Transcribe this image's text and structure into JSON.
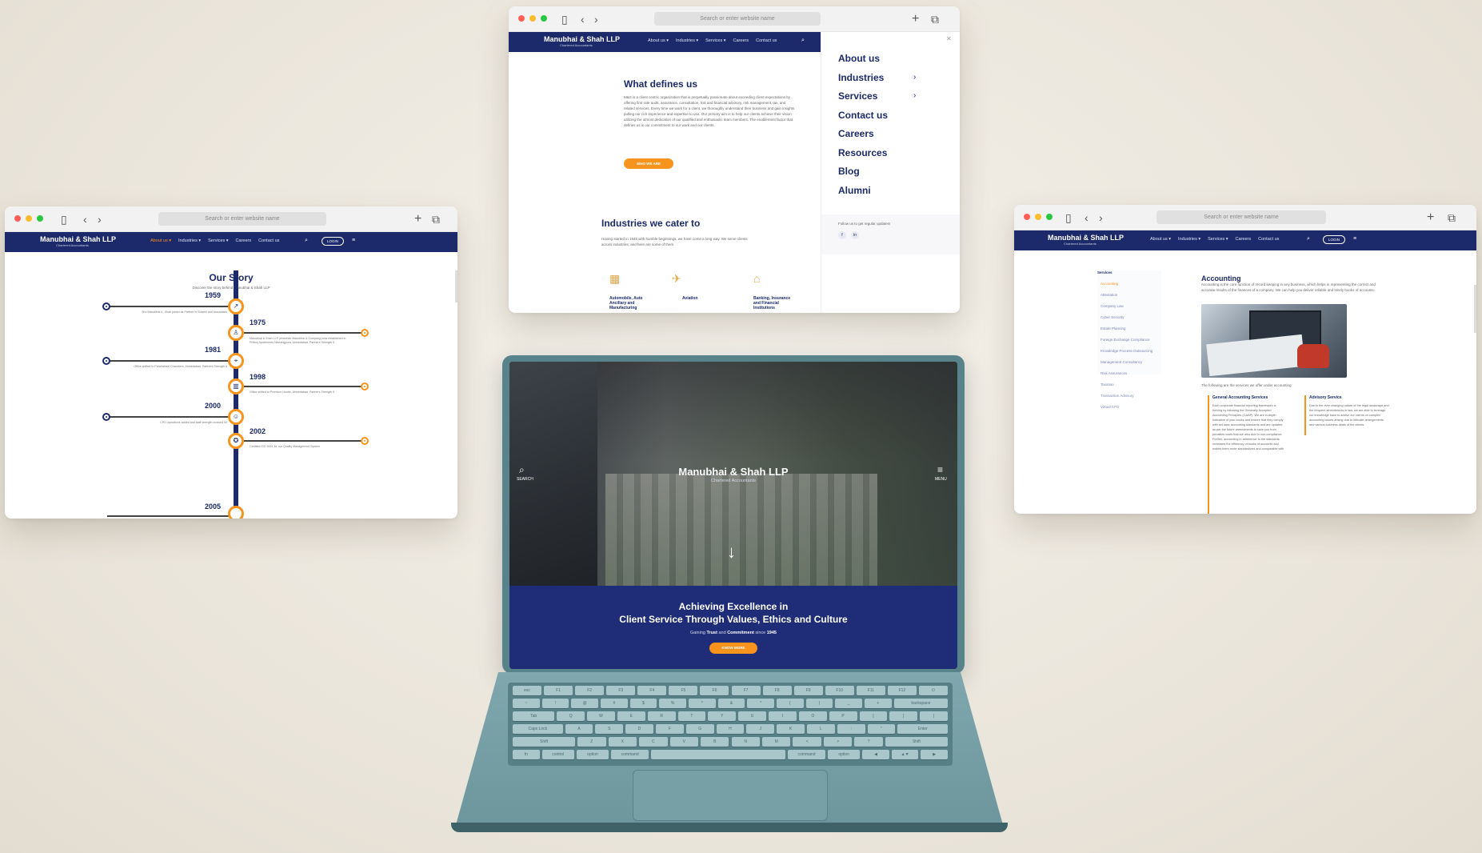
{
  "colors": {
    "navy": "#1c2a6b",
    "orange": "#f7941d",
    "hero_band": "#1f2d78"
  },
  "browser": {
    "url_placeholder": "Search or enter website name",
    "icons": [
      "sidebar-icon",
      "back-icon",
      "forward-icon",
      "new-tab-icon",
      "tabs-icon"
    ]
  },
  "brand": {
    "name": "Manubhai & Shah LLP",
    "tagline": "Chartered Accountants"
  },
  "nav": {
    "about": "About us ▾",
    "industries": "Industries ▾",
    "services": "Services ▾",
    "careers": "Careers",
    "contact": "Contact us",
    "login": "LOGIN"
  },
  "top_window": {
    "heading": "What defines us",
    "body": "M&S is a client centric organization that is perpetually passionate about exceeding client expectations by offering first rate audit, assurance, consultation, risk and financial advisory, risk management, tax, and related services. Every time we work for a client, we thoroughly understand their business and gain insights pulling our rich experience and expertise to use. Our primary aim is to help our clients achieve their vision utilizing the utmost dedication of our qualified and enthusiastic team members. The enablement factor that defines us is our commitment to our work and our clients.",
    "button": "WHO WE ARE",
    "industries_heading": "Industries we cater to",
    "industries_sub": "Having started in 1945 with humble beginnings, we have come a long way. We serve clients across industries, and here are some of them.",
    "industries": [
      {
        "label": "Automobile, Auto Ancillary and Manufacturing",
        "icon": "factory-icon"
      },
      {
        "label": "Aviation",
        "icon": "airplane-icon"
      },
      {
        "label": "Banking, Insurance and Financial Institutions",
        "icon": "bank-icon"
      }
    ],
    "menu": [
      "About us",
      "Industries",
      "Services",
      "Contact us",
      "Careers",
      "Resources",
      "Blog",
      "Alumni"
    ],
    "follow": "Follow us to get regular updates!",
    "social": [
      "f",
      "in"
    ]
  },
  "left_window": {
    "heading": "Our Story",
    "sub": "Discover the story behind Manubhai & Shah LLP",
    "timeline": [
      {
        "year": "1959",
        "side": "left",
        "text": "Shri Manubhai K. Shah joined as Partner in Solanki and Associates"
      },
      {
        "year": "1975",
        "side": "right",
        "text": "Manubhai & Shah LLP (erstwhile Manubhai & Company) was established in Pritikuj Apartments Navrangpura, Ahmedabad. Partners Strength 5"
      },
      {
        "year": "1981",
        "side": "left",
        "text": "Office shifted to Panchsheel Chambers, Ahmedabad. Partners Strength 8"
      },
      {
        "year": "1998",
        "side": "right",
        "text": "Office shifted to Premium House, Ahmedabad. Partners Strength 9"
      },
      {
        "year": "2000",
        "side": "left",
        "text": "CPO operations added and staff strength crossed 50"
      },
      {
        "year": "2002",
        "side": "right",
        "text": "Certified ISO 9001 for our Quality Management System"
      },
      {
        "year": "2005",
        "side": "left",
        "text": ""
      }
    ]
  },
  "right_window": {
    "sidebar_title": "Services",
    "sidebar": [
      "Accounting",
      "Attestation",
      "Company Law",
      "Cyber Security",
      "Estate Planning",
      "Foreign Exchange Compliance",
      "Knowledge Process Outsourcing",
      "Management Consultancy",
      "Risk Assurances",
      "Taxation",
      "Transaction Advisory",
      "Virtual CFO"
    ],
    "title": "Accounting",
    "intro": "Accounting is the core function of record keeping in any business, which helps in representing the correct and accurate results of the finances of a company. We can help you deliver reliable and timely books of accounts.",
    "offer": "The following are the services we offer under accounting:",
    "col1_title": "General Accounting Services",
    "col1_text": "Each corporate financial reporting framework is thriving by following the Generally Accepted Accounting Principles (GAAP). We are in-depth indicative of your books and ensure that they comply with set laws accounting standards and are updated as per the future amendments to save you from penalties costs that are also due to non-compliance. Further, accounting in adherence to the standards increases the efficiency of books of accounts and makes them more standardized and comparable with",
    "col2_title": "Advisory Service",
    "col2_text": "Due to the ever changing nature of the legal landscape and the frequent amendments in law, we are able to leverage our knowledge base to advise our clients on complex accounting issues arising due to intricate arrangements and various business deals of the clients."
  },
  "laptop": {
    "brand": "Manubhai & Shah LLP",
    "tagline": "Chartered Accountants",
    "search": "SEARCH",
    "menu": "MENU",
    "headline1": "Achieving Excellence in",
    "headline2": "Client Service Through Values, Ethics and Culture",
    "sub_prefix": "Gaining",
    "sub_trust": "Trust",
    "sub_and": "and",
    "sub_commitment": "Commitment",
    "sub_since": "since",
    "sub_year": "1945",
    "button": "KNOW MORE",
    "keys": {
      "row0": [
        "esc",
        "F1",
        "F2",
        "F3",
        "F4",
        "F5",
        "F6",
        "F7",
        "F8",
        "F9",
        "F10",
        "F11",
        "F12",
        "⏻"
      ],
      "row1": [
        "~",
        "!",
        "@",
        "#",
        "$",
        "%",
        "^",
        "&",
        "*",
        "(",
        ")",
        "_",
        "+",
        "backspace"
      ],
      "row2": [
        "Tab",
        "Q",
        "W",
        "E",
        "R",
        "T",
        "Y",
        "U",
        "I",
        "O",
        "P",
        "{",
        "}",
        "|"
      ],
      "row3": [
        "Caps Lock",
        "A",
        "S",
        "D",
        "F",
        "G",
        "H",
        "J",
        "K",
        "L",
        ":",
        "\"",
        "Enter"
      ],
      "row4": [
        "Shift",
        "Z",
        "X",
        "C",
        "V",
        "B",
        "N",
        "M",
        "<",
        ">",
        "?",
        "Shift"
      ],
      "row5": [
        "fn",
        "control",
        "option",
        "command",
        "",
        "command",
        "option",
        "◀",
        "▲▼",
        "▶"
      ]
    }
  }
}
